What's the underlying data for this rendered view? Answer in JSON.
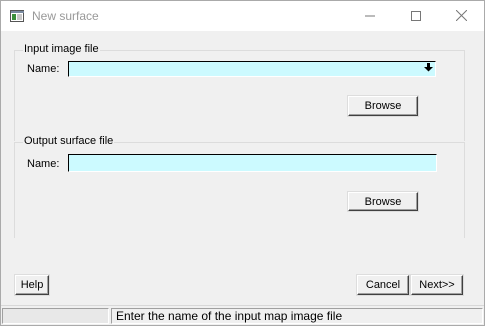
{
  "window": {
    "title": "New surface",
    "icon": "app-window-icon"
  },
  "input_group": {
    "legend": "Input image file",
    "name_label": "Name:",
    "name_value": "",
    "browse_label": "Browse",
    "field_color": "#ccfaff"
  },
  "output_group": {
    "legend": "Output surface file",
    "name_label": "Name:",
    "name_value": "",
    "browse_label": "Browse"
  },
  "buttons": {
    "help": "Help",
    "cancel": "Cancel",
    "next": "Next>>"
  },
  "status": {
    "left": "",
    "message": "Enter the name of the input map image file"
  }
}
